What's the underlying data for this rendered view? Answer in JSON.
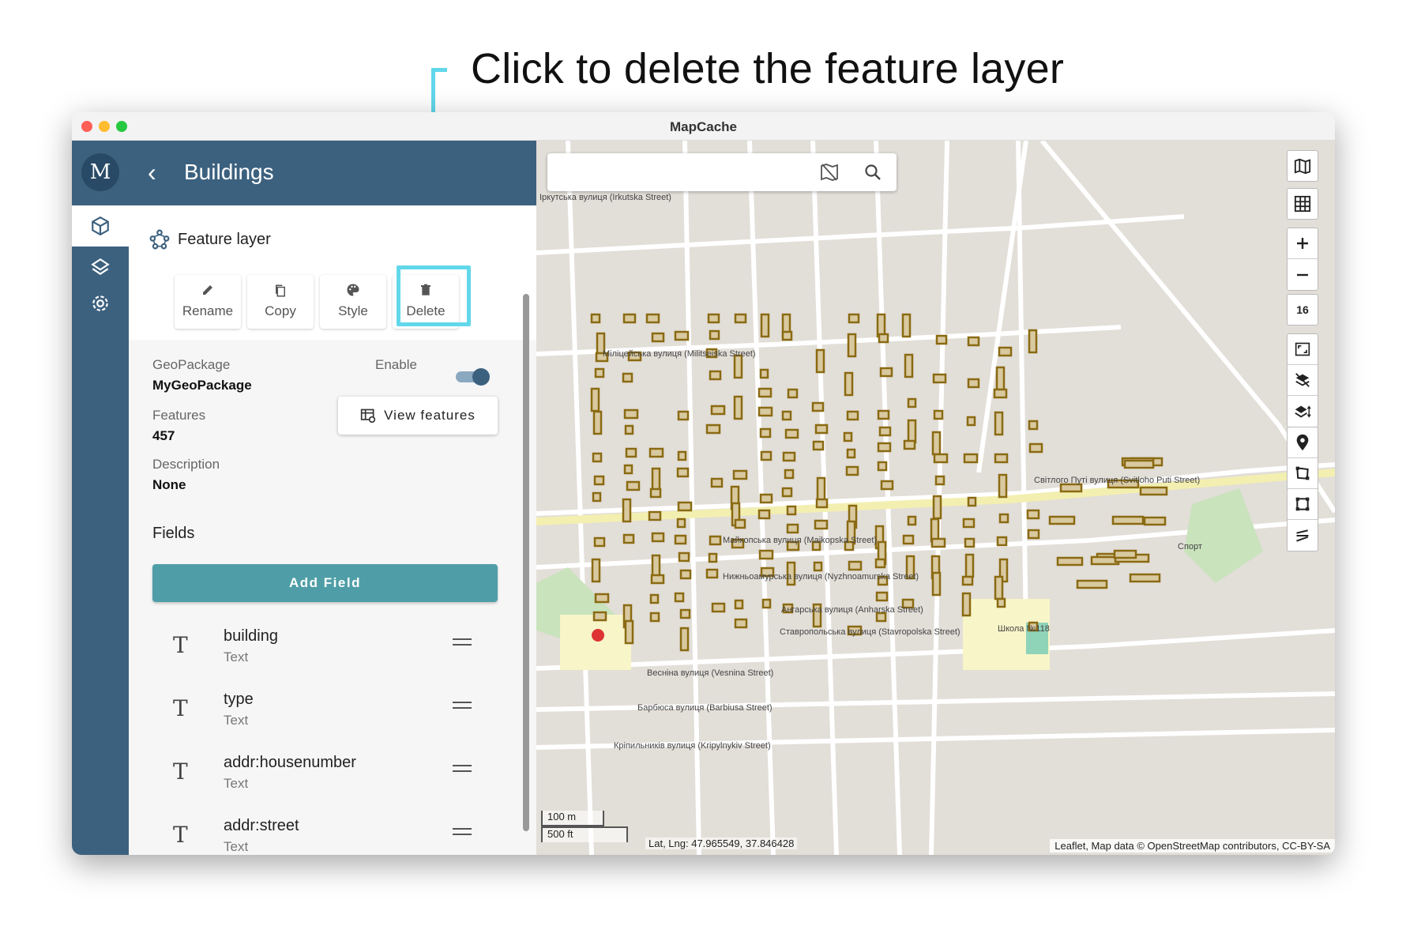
{
  "annotation": {
    "callout": "Click to delete the feature layer"
  },
  "window": {
    "title": "MapCache"
  },
  "rail": {
    "logo": "M"
  },
  "header": {
    "back_icon": "chevron-left-icon",
    "title": "Buildings"
  },
  "layer": {
    "type_label": "Feature layer",
    "actions": [
      {
        "label": "Rename",
        "icon": "pencil-icon"
      },
      {
        "label": "Copy",
        "icon": "copy-icon"
      },
      {
        "label": "Style",
        "icon": "palette-icon"
      },
      {
        "label": "Delete",
        "icon": "trash-icon"
      }
    ]
  },
  "details": {
    "geopackage_label": "GeoPackage",
    "geopackage_value": "MyGeoPackage",
    "enable_label": "Enable",
    "enabled": true,
    "features_label": "Features",
    "features_value": "457",
    "view_features_label": "View features",
    "description_label": "Description",
    "description_value": "None"
  },
  "fields": {
    "title": "Fields",
    "add_label": "Add Field",
    "items": [
      {
        "icon": "T",
        "name": "building",
        "type": "Text"
      },
      {
        "icon": "T",
        "name": "type",
        "type": "Text"
      },
      {
        "icon": "T",
        "name": "addr:housenumber",
        "type": "Text"
      },
      {
        "icon": "T",
        "name": "addr:street",
        "type": "Text"
      }
    ]
  },
  "map": {
    "zoom": "16",
    "scale_metric": "100 m",
    "scale_imperial": "500 ft",
    "latlng": "Lat, Lng: 47.965549, 37.846428",
    "attribution": "Leaflet, Map data © OpenStreetMap contributors, CC-BY-SA",
    "streets": [
      "Іркутська вулиця (Irkutska Street)",
      "Міліцейська вулиця (Militseiska Street)",
      "Світлого Путі вулиця (Svitloho Puti Street)",
      "Майкопська вулиця (Maikopska Street)",
      "Нижньоамурська вулиця (Nyzhnoamurska Street)",
      "Ангарська вулиця (Anharska Street)",
      "Ставропольська вулиця (Stavropolska Street)",
      "Весніна вулиця (Vesnina Street)",
      "Барбюса вулиця (Barbiusa Street)",
      "Кріпильників вулиця (Kripylnykiv Street)",
      "Спорт",
      "Школа №118"
    ]
  },
  "colors": {
    "primary": "#3c617f",
    "accent": "#4f9ea7",
    "callout": "#62d7ea",
    "building": "#8a6a12"
  }
}
